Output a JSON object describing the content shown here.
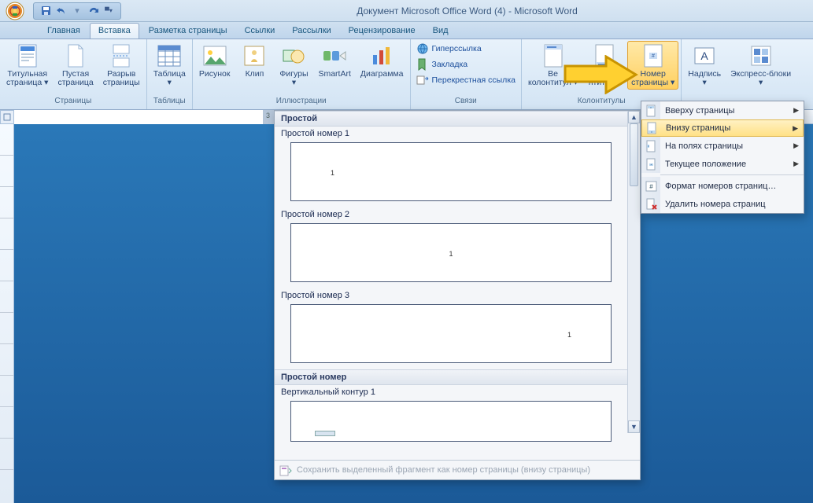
{
  "title": "Документ Microsoft Office Word (4) - Microsoft Word",
  "tabs": {
    "home": "Главная",
    "insert": "Вставка",
    "layout": "Разметка страницы",
    "refs": "Ссылки",
    "mail": "Рассылки",
    "review": "Рецензирование",
    "view": "Вид"
  },
  "ribbon": {
    "pages": {
      "label": "Страницы",
      "cover": "Титульная\nстраница ▾",
      "blank": "Пустая\nстраница",
      "break": "Разрыв\nстраницы"
    },
    "tables": {
      "label": "Таблицы",
      "table": "Таблица\n▾"
    },
    "illus": {
      "label": "Иллюстрации",
      "picture": "Рисунок",
      "clip": "Клип",
      "shapes": "Фигуры\n▾",
      "smartart": "SmartArt",
      "chart": "Диаграмма"
    },
    "links": {
      "label": "Связи",
      "hyper": "Гиперссылка",
      "bookmark": "Закладка",
      "cross": "Перекрестная ссылка"
    },
    "hf": {
      "label": "Колонтитулы",
      "header": "Ве\nколонтитул ▾",
      "footer": "й\nнтитул ▾",
      "pageno": "Номер\nстраницы ▾"
    },
    "text": {
      "label": "",
      "textbox": "Надпись\n▾",
      "quick": "Экспресс-блоки\n▾"
    }
  },
  "menu": {
    "top": "Вверху страницы",
    "bottom": "Внизу страницы",
    "margins": "На полях страницы",
    "current": "Текущее положение",
    "format": "Формат номеров страниц…",
    "remove": "Удалить номера страниц"
  },
  "gallery": {
    "header1": "Простой",
    "item1": "Простой номер 1",
    "item2": "Простой номер 2",
    "item3": "Простой номер 3",
    "header2": "Простой номер",
    "item4": "Вертикальный контур 1",
    "footer": "Сохранить выделенный фрагмент как номер страницы (внизу страницы)",
    "pgnum": "1"
  },
  "ruler_num": "3"
}
